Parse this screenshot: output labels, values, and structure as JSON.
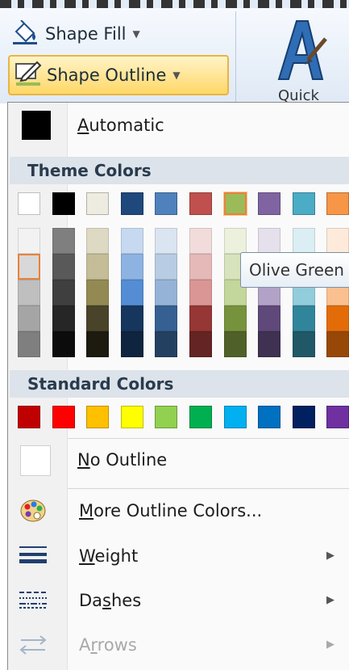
{
  "ribbon": {
    "shape_fill_label": "Shape Fill",
    "shape_outline_label": "Shape Outline",
    "quick_styles_label": "Quick"
  },
  "menu": {
    "automatic_label": "Automatic",
    "theme_colors_header": "Theme Colors",
    "standard_colors_header": "Standard Colors",
    "no_outline_label": "No Outline",
    "more_colors_label": "More Outline Colors...",
    "weight_label": "Weight",
    "dashes_label": "Dashes",
    "arrows_label": "Arrows",
    "tooltip": "Olive Green"
  },
  "theme_colors": {
    "top_row": [
      "#ffffff",
      "#000000",
      "#eeece1",
      "#1f497d",
      "#4f81bd",
      "#c0504d",
      "#9bbb59",
      "#8064a2",
      "#4bacc6",
      "#f79646"
    ],
    "selected_top_index": 6,
    "shades": [
      [
        "#f2f2f2",
        "#d8d8d8",
        "#bfbfbf",
        "#a5a5a5",
        "#7f7f7f"
      ],
      [
        "#7f7f7f",
        "#595959",
        "#3f3f3f",
        "#262626",
        "#0c0c0c"
      ],
      [
        "#ddd9c3",
        "#c4bd97",
        "#938953",
        "#494429",
        "#1d1b10"
      ],
      [
        "#c6d9f0",
        "#8db3e2",
        "#548dd4",
        "#17365d",
        "#0f243e"
      ],
      [
        "#dbe5f1",
        "#b8cce4",
        "#95b3d7",
        "#366092",
        "#244061"
      ],
      [
        "#f2dcdb",
        "#e5b9b7",
        "#d99694",
        "#953734",
        "#632423"
      ],
      [
        "#ebf1dd",
        "#d7e3bc",
        "#c3d69b",
        "#76923c",
        "#4f6128"
      ],
      [
        "#e5e0ec",
        "#ccc1d9",
        "#b2a2c7",
        "#5f497a",
        "#3f3151"
      ],
      [
        "#dbeef3",
        "#b7dde8",
        "#92cddc",
        "#31859b",
        "#205867"
      ],
      [
        "#fdeada",
        "#fbd5b5",
        "#fac08f",
        "#e36c09",
        "#974806"
      ]
    ],
    "selected_shade": [
      0,
      1
    ]
  },
  "standard_colors": [
    "#c00000",
    "#ff0000",
    "#ffc000",
    "#ffff00",
    "#92d050",
    "#00b050",
    "#00b0f0",
    "#0070c0",
    "#002060",
    "#7030a0"
  ],
  "icons": {
    "shape_fill": "paint-bucket-icon",
    "shape_outline": "pencil-outline-icon",
    "quick_styles": "quick-styles-a-icon",
    "more_colors": "color-palette-icon",
    "weight": "line-weight-icon",
    "dashes": "dashes-icon",
    "arrows": "arrows-icon"
  }
}
